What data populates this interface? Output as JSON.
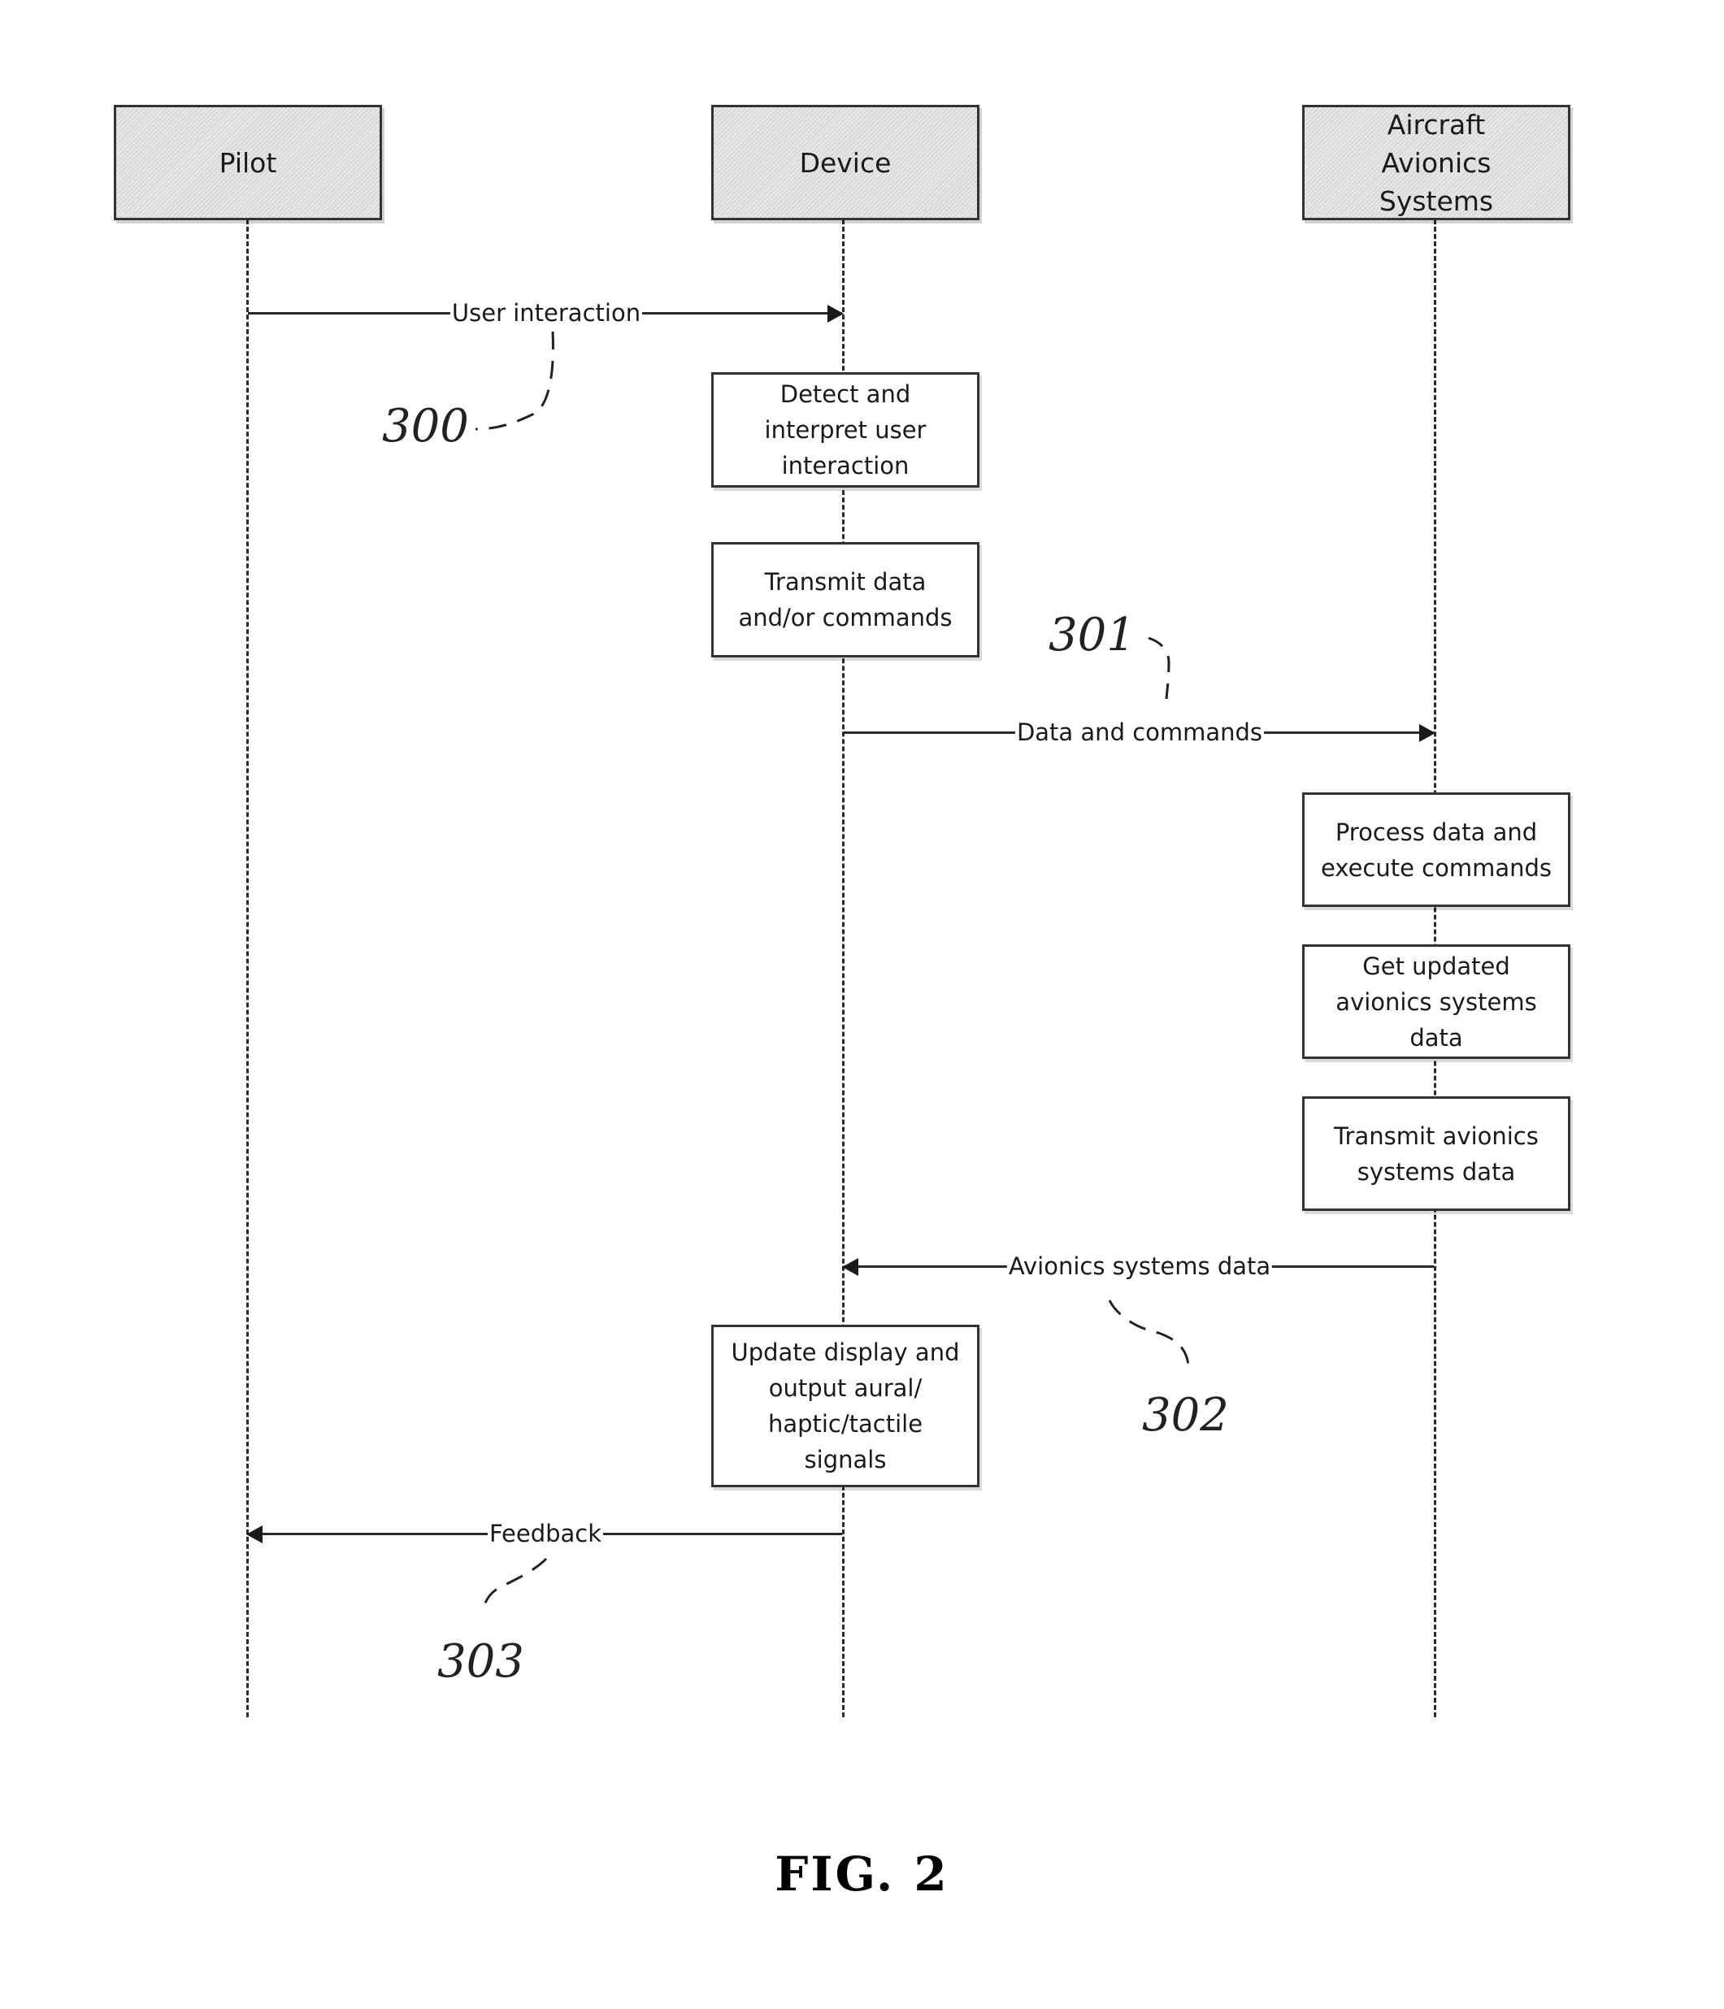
{
  "participants": [
    {
      "id": "pilot",
      "label": "Pilot"
    },
    {
      "id": "device",
      "label": "Device"
    },
    {
      "id": "avionics",
      "label": "Aircraft Avionics Systems"
    }
  ],
  "steps": {
    "device": [
      {
        "label": "Detect and\ninterpret user\ninteraction"
      },
      {
        "label": "Transmit data\nand/or commands"
      },
      {
        "label": "Update display and\noutput aural/\nhaptic/tactile\nsignals"
      }
    ],
    "avionics": [
      {
        "label": "Process data and\nexecute commands"
      },
      {
        "label": "Get updated\navionics systems\ndata"
      },
      {
        "label": "Transmit avionics\nsystems data"
      }
    ]
  },
  "messages": [
    {
      "from": "pilot",
      "to": "device",
      "label": "User interaction",
      "ref": "300"
    },
    {
      "from": "device",
      "to": "avionics",
      "label": "Data and commands",
      "ref": "301"
    },
    {
      "from": "avionics",
      "to": "device",
      "label": "Avionics systems data",
      "ref": "302"
    },
    {
      "from": "device",
      "to": "pilot",
      "label": "Feedback",
      "ref": "303"
    }
  ],
  "caption": "FIG. 2"
}
